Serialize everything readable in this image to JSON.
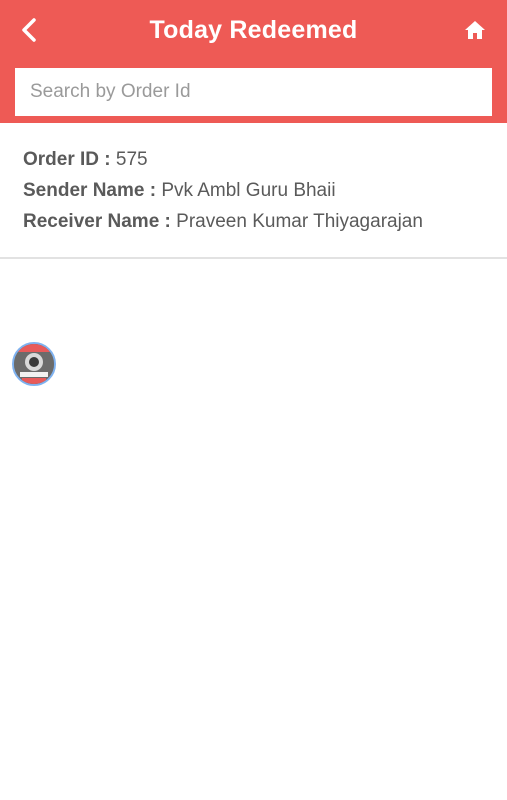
{
  "header": {
    "title": "Today Redeemed",
    "back_icon": "chevron-left-icon",
    "home_icon": "home-icon",
    "color": "#ee5a55"
  },
  "search": {
    "placeholder": "Search by Order Id",
    "value": ""
  },
  "orders": [
    {
      "order_id_label": "Order ID :",
      "order_id": "575",
      "sender_label": "Sender Name :",
      "sender": "Pvk Ambl Guru Bhaii",
      "receiver_label": "Receiver Name :",
      "receiver": "Praveen Kumar Thiyagarajan"
    }
  ],
  "floating_button": {
    "icon": "avatar-thumbnail"
  }
}
